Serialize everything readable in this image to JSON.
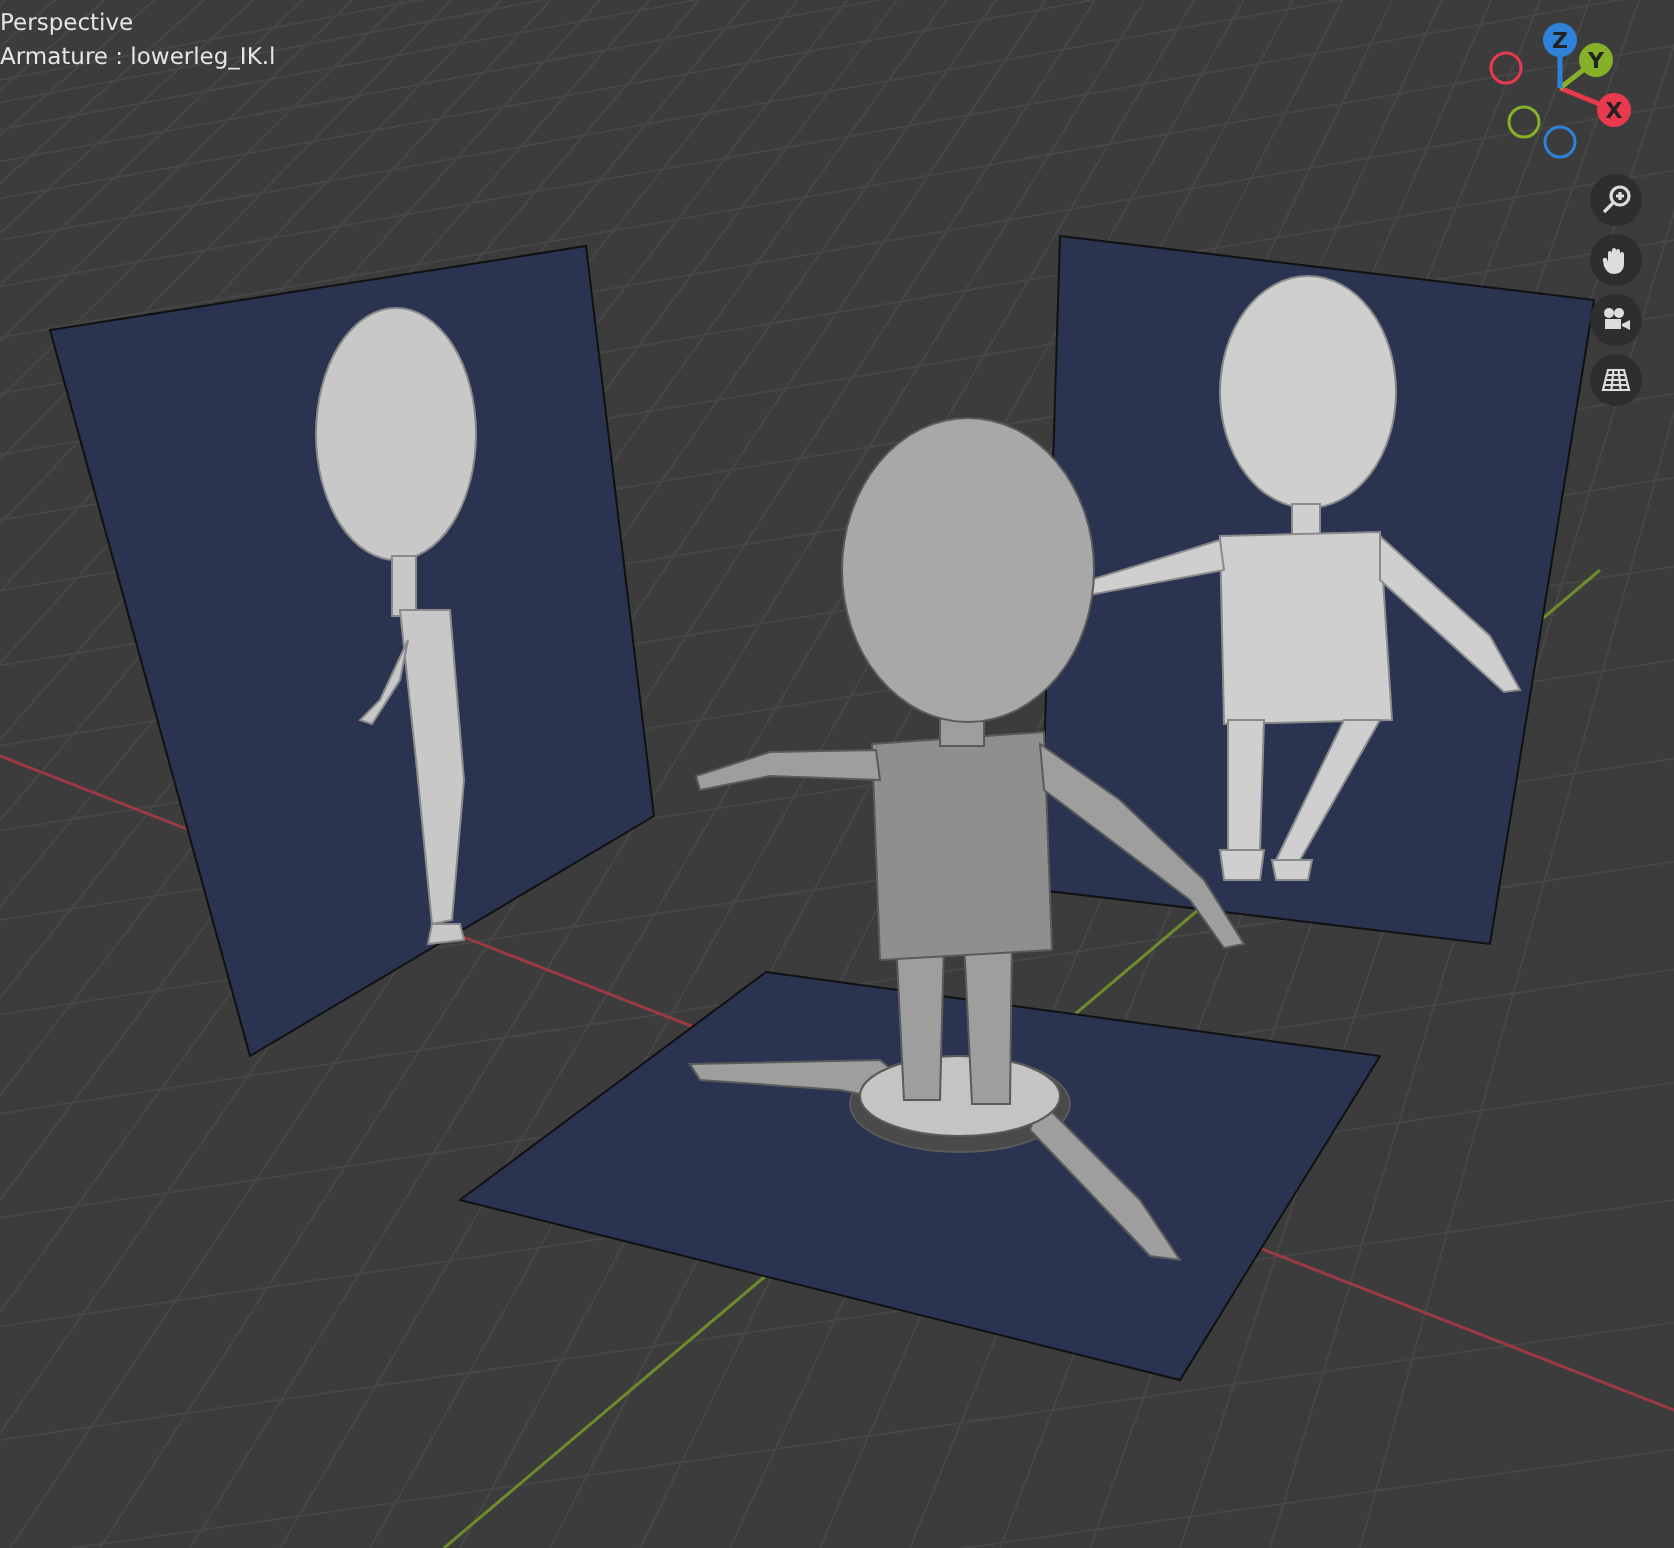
{
  "viewport": {
    "view_name": "Perspective",
    "active_object": "Armature : lowerleg_IK.l"
  },
  "gizmo": {
    "axes": [
      {
        "label": "X",
        "color": "#e8394d"
      },
      {
        "label": "Y",
        "color": "#86b027"
      },
      {
        "label": "Z",
        "color": "#2e82d8"
      }
    ]
  }
}
